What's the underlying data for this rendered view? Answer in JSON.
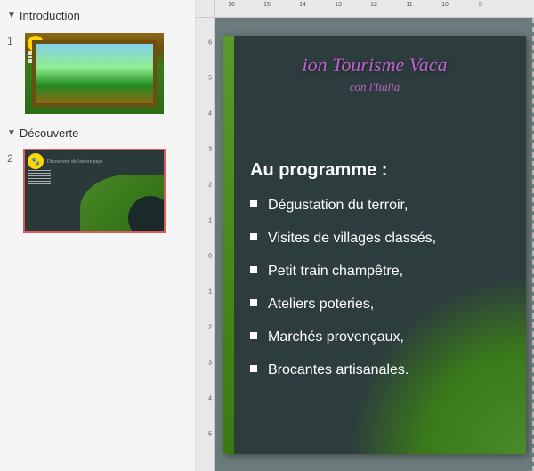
{
  "navigator": {
    "sections": [
      {
        "name": "Introduction",
        "expanded": true,
        "slides": [
          {
            "number": "1",
            "selected": false
          }
        ]
      },
      {
        "name": "Découverte",
        "expanded": true,
        "slides": [
          {
            "number": "2",
            "selected": true
          }
        ]
      }
    ]
  },
  "slide": {
    "title_line1": "ion Tourisme Vaca",
    "title_line2": "con l'Italia",
    "programme_heading": "Au programme :",
    "items": [
      "Dégustation du terroir,",
      "Visites de villages classés,",
      "Petit train champêtre,",
      "Ateliers poteries,",
      "Marchés provençaux,",
      "Brocantes artisanales."
    ]
  },
  "ruler": {
    "h_labels": [
      "16",
      "15",
      "14",
      "13",
      "12",
      "11",
      "10",
      "9"
    ],
    "v_labels": [
      "6",
      "5",
      "4",
      "3",
      "2",
      "1",
      "0",
      "1",
      "2",
      "3",
      "4",
      "5"
    ]
  }
}
